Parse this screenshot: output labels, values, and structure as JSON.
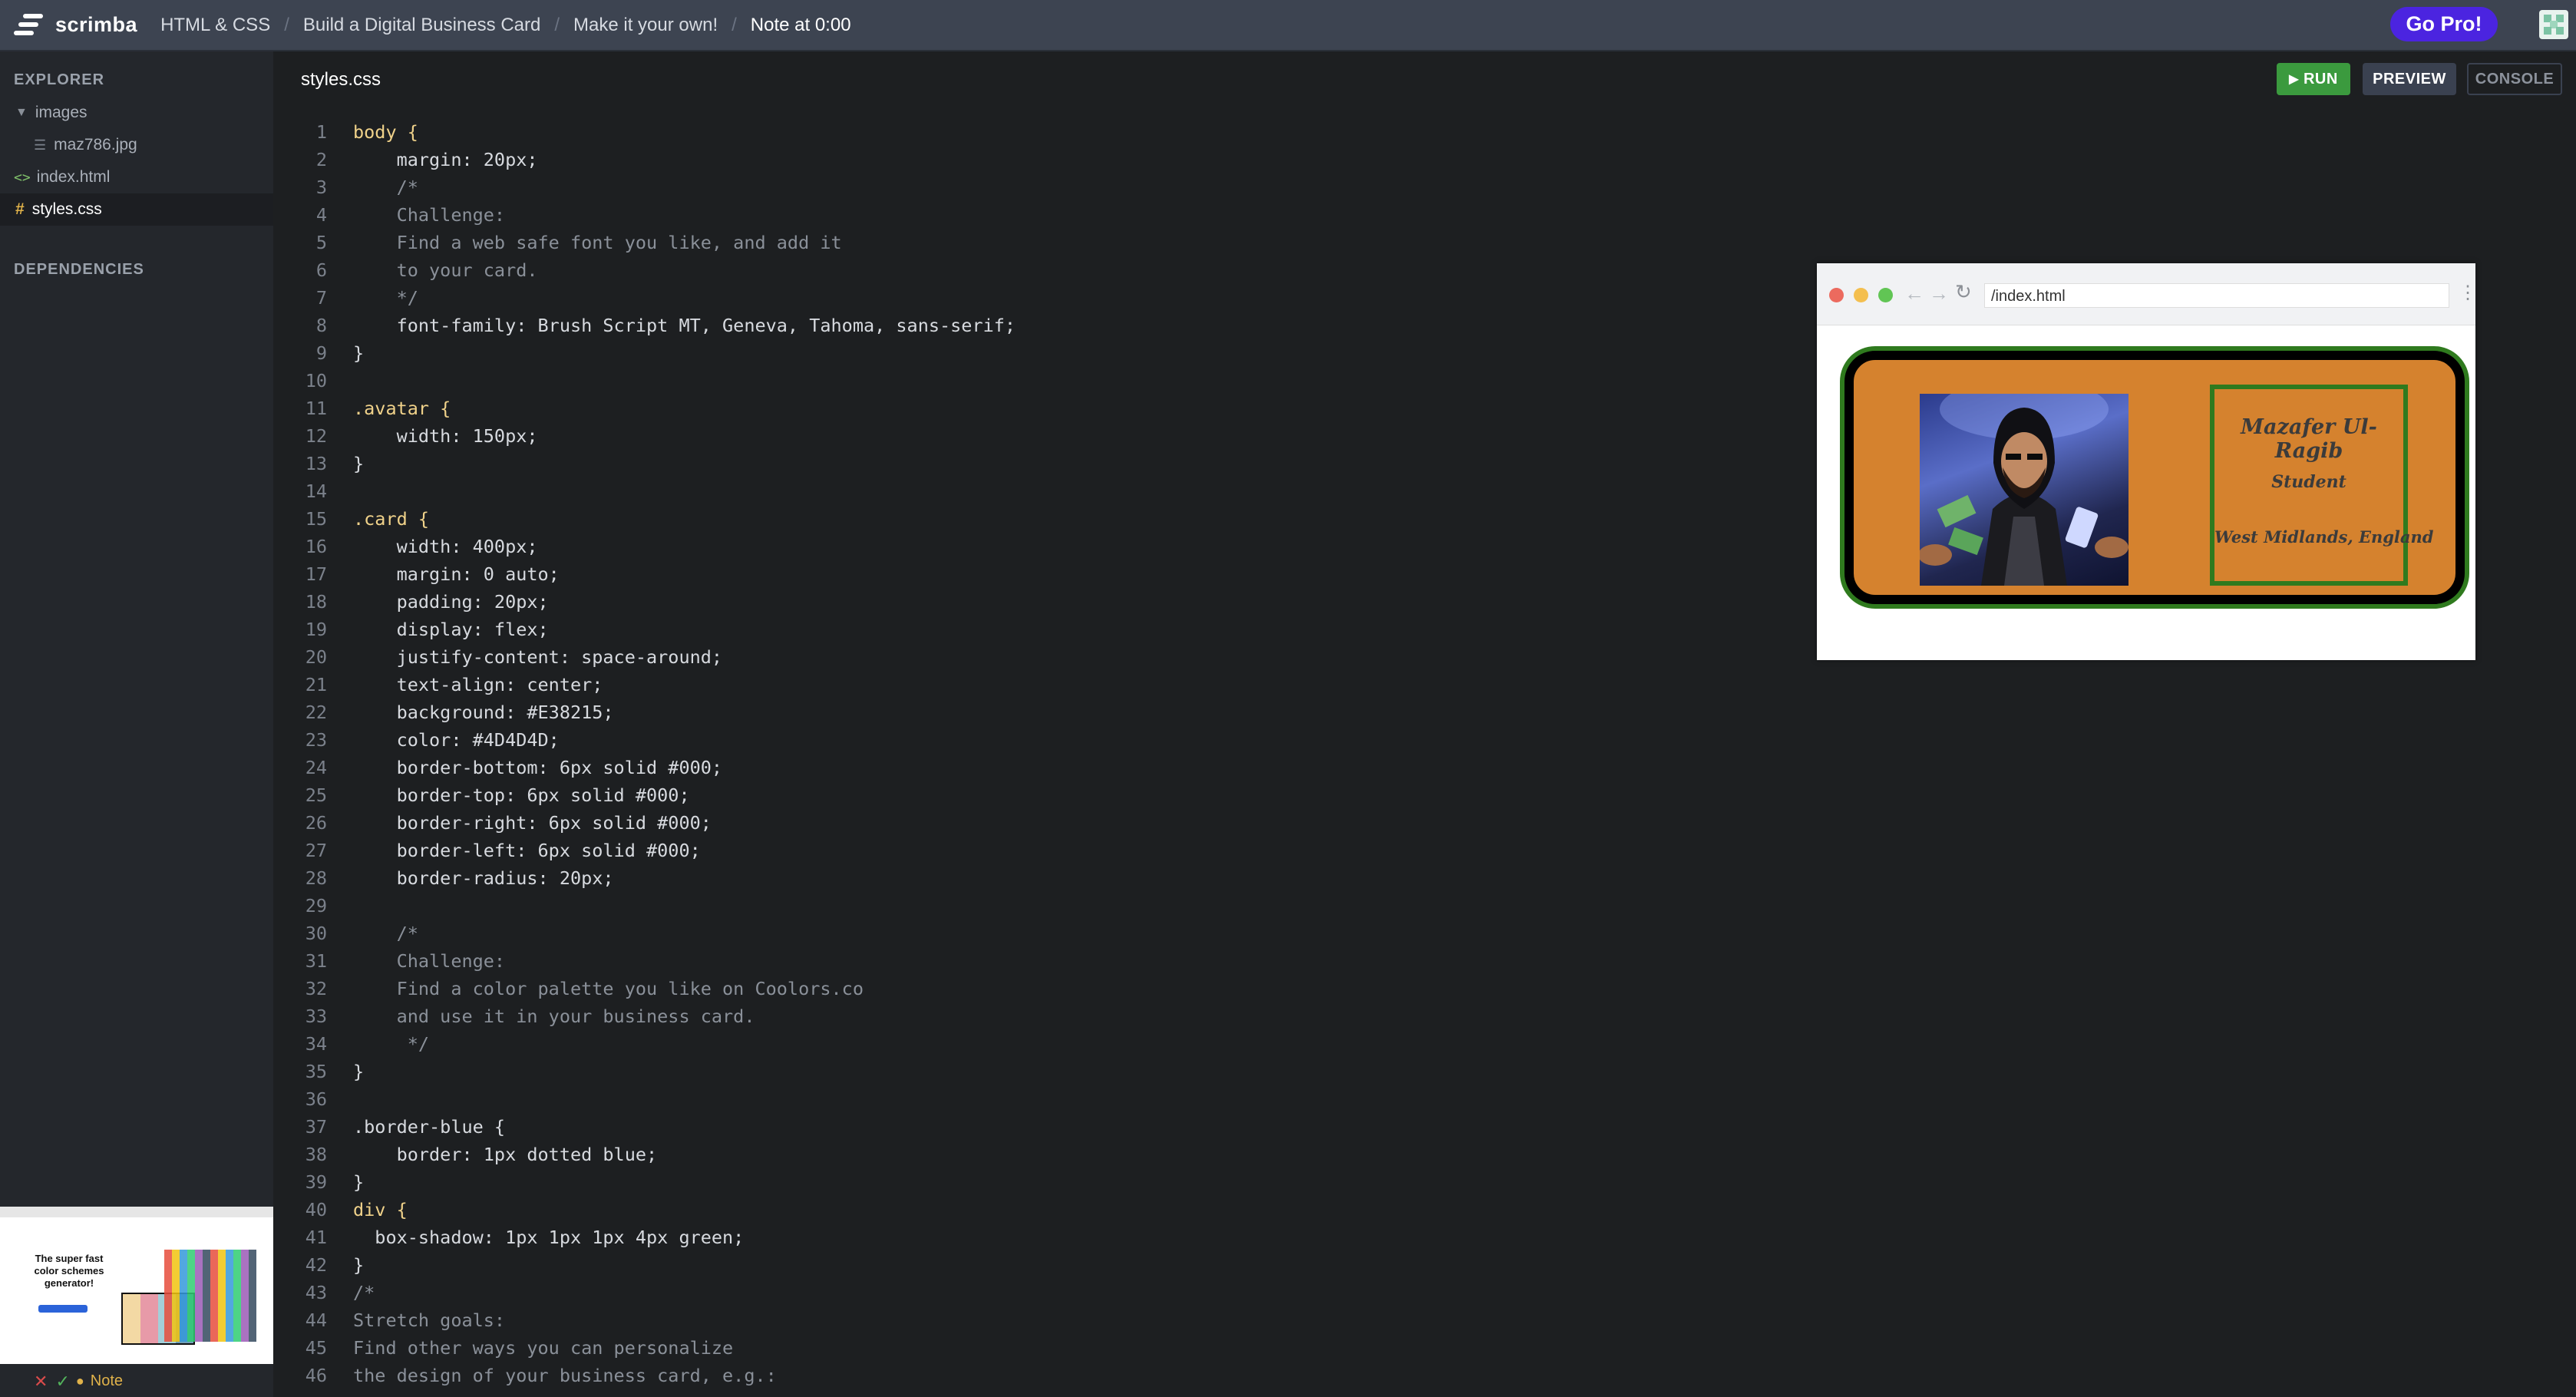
{
  "app": {
    "name": "scrimba"
  },
  "breadcrumbs": [
    "HTML & CSS",
    "Build a Digital Business Card",
    "Make it your own!",
    "Note at 0:00"
  ],
  "header": {
    "go_pro": "Go Pro!"
  },
  "sidebar": {
    "explorer_title": "EXPLORER",
    "folder": "images",
    "image_file": "maz786.jpg",
    "files": [
      "index.html",
      "styles.css"
    ],
    "dependencies_title": "DEPENDENCIES",
    "note_label": "Note"
  },
  "editor": {
    "tab": "styles.css",
    "run": "RUN",
    "preview": "PREVIEW",
    "console": "CONSOLE"
  },
  "code_lines": [
    "body {",
    "    margin: 20px;",
    "    /*",
    "    Challenge:",
    "    Find a web safe font you like, and add it",
    "    to your card.",
    "    */",
    "    font-family: Brush Script MT, Geneva, Tahoma, sans-serif;",
    "}",
    "",
    ".avatar {",
    "    width: 150px;",
    "}",
    "",
    ".card {",
    "    width: 400px;",
    "    margin: 0 auto;",
    "    padding: 20px;",
    "    display: flex;",
    "    justify-content: space-around;",
    "    text-align: center;",
    "    background: #E38215;",
    "    color: #4D4D4D;",
    "    border-bottom: 6px solid #000;",
    "    border-top: 6px solid #000;",
    "    border-right: 6px solid #000;",
    "    border-left: 6px solid #000;",
    "    border-radius: 20px;",
    "",
    "    /*",
    "    Challenge:",
    "    Find a color palette you like on Coolors.co",
    "    and use it in your business card.",
    "     */",
    "}",
    "",
    ".border-blue {",
    "    border: 1px dotted blue;",
    "}",
    "div {",
    "  box-shadow: 1px 1px 1px 4px green;",
    "}",
    "/*",
    "Stretch goals:",
    "Find other ways you can personalize",
    "the design of your business card, e.g.:"
  ],
  "preview": {
    "url": "/index.html",
    "name": "Mazafer Ul-Ragib",
    "role": "Student",
    "location": "West Midlands, England"
  },
  "thumbnail": {
    "headline": "The super fast color schemes generator!"
  },
  "colors": {
    "topbar": "#3d4451",
    "accent": "#4b24e0",
    "run": "#3b9a3e",
    "card_bg": "#d5822e",
    "card_border": "#2f7a1e"
  }
}
